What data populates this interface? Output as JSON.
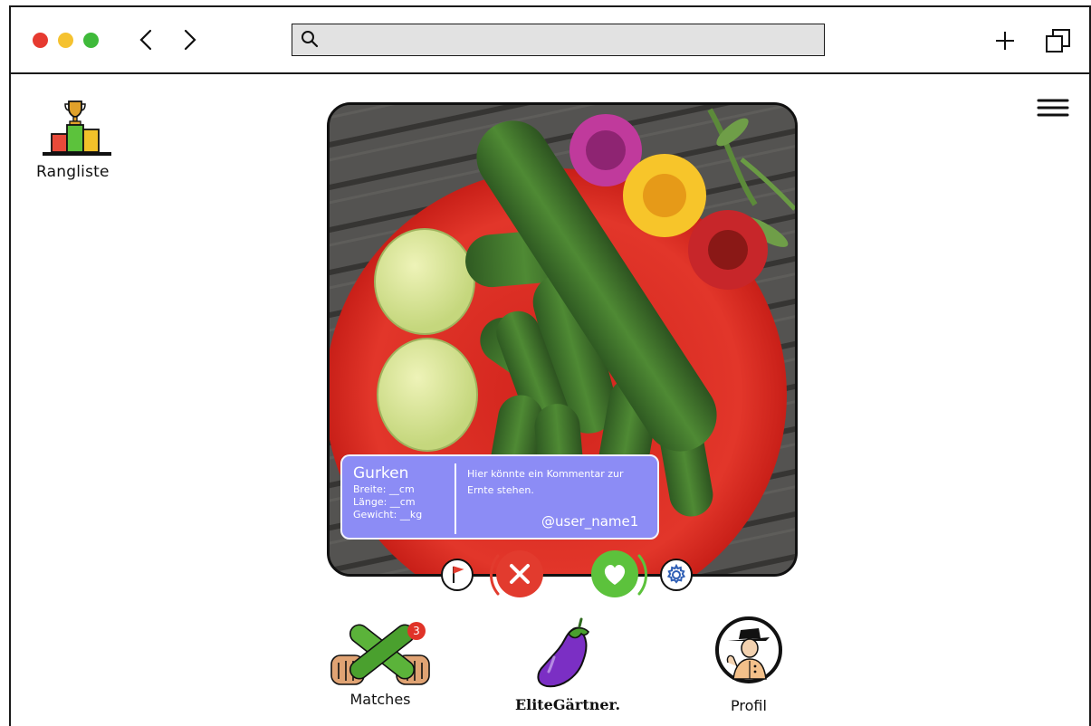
{
  "browser": {
    "search": {
      "value": "",
      "placeholder": ""
    }
  },
  "ranking": {
    "label": "Rangliste"
  },
  "post": {
    "title": "Gurken",
    "width": "Breite: __cm",
    "length": "Länge: __cm",
    "weight": "Gewicht: __kg",
    "comment": "Hier könnte ein Kommentar zur Ernte stehen.",
    "user": "@user_name1"
  },
  "nav": {
    "matches": "Matches",
    "matches_badge": "3",
    "brand": "EliteGärtner.",
    "profile": "Profil"
  },
  "colors": {
    "info_box": "#8c8cf5",
    "reject": "#e23b2e",
    "like": "#5cc23c",
    "eggplant": "#7b2fc4"
  }
}
